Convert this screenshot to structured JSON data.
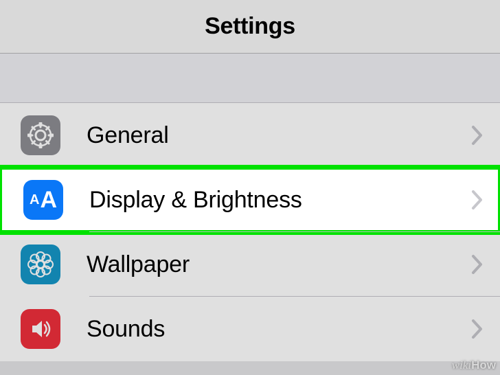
{
  "header": {
    "title": "Settings"
  },
  "rows": [
    {
      "label": "General",
      "icon": "gear",
      "highlighted": false
    },
    {
      "label": "Display & Brightness",
      "icon": "display",
      "highlighted": true
    },
    {
      "label": "Wallpaper",
      "icon": "wallpaper",
      "highlighted": false
    },
    {
      "label": "Sounds",
      "icon": "sounds",
      "highlighted": false
    }
  ],
  "watermark": {
    "part1": "wiki",
    "part2": "How"
  }
}
